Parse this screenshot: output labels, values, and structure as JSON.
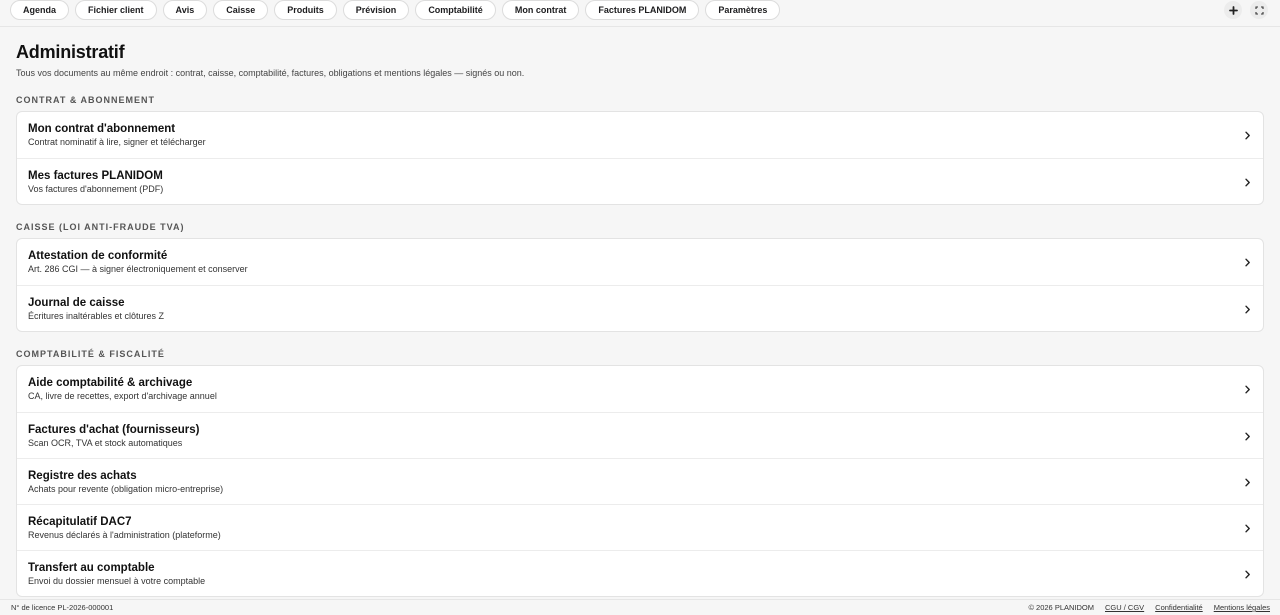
{
  "tabs": [
    "Agenda",
    "Fichier client",
    "Avis",
    "Caisse",
    "Produits",
    "Prévision",
    "Comptabilité",
    "Mon contrat",
    "Factures PLANIDOM",
    "Paramètres"
  ],
  "top_icons": [
    "plus-icon",
    "fullscreen-icon"
  ],
  "page": {
    "title": "Administratif",
    "subtitle": "Tous vos documents au même endroit : contrat, caisse, comptabilité, factures, obligations et mentions légales — signés ou non."
  },
  "sections": [
    {
      "title": "Contrat & abonnement",
      "items": [
        {
          "title": "Mon contrat d'abonnement",
          "desc": "Contrat nominatif à lire, signer et télécharger"
        },
        {
          "title": "Mes factures PLANIDOM",
          "desc": "Vos factures d'abonnement (PDF)"
        }
      ]
    },
    {
      "title": "Caisse (loi anti-fraude TVA)",
      "items": [
        {
          "title": "Attestation de conformité",
          "desc": "Art. 286 CGI — à signer électroniquement et conserver"
        },
        {
          "title": "Journal de caisse",
          "desc": "Écritures inaltérables et clôtures Z"
        }
      ]
    },
    {
      "title": "Comptabilité & fiscalité",
      "items": [
        {
          "title": "Aide comptabilité & archivage",
          "desc": "CA, livre de recettes, export d'archivage annuel"
        },
        {
          "title": "Factures d'achat (fournisseurs)",
          "desc": "Scan OCR, TVA et stock automatiques"
        },
        {
          "title": "Registre des achats",
          "desc": "Achats pour revente (obligation micro-entreprise)"
        },
        {
          "title": "Récapitulatif DAC7",
          "desc": "Revenus déclarés à l'administration (plateforme)"
        },
        {
          "title": "Transfert au comptable",
          "desc": "Envoi du dossier mensuel à votre comptable"
        }
      ]
    }
  ],
  "footer": {
    "license": "N° de licence PL-2026-000001",
    "copyright": "© 2026 PLANIDOM",
    "links": [
      "CGU / CGV",
      "Confidentialité",
      "Mentions légales"
    ]
  }
}
